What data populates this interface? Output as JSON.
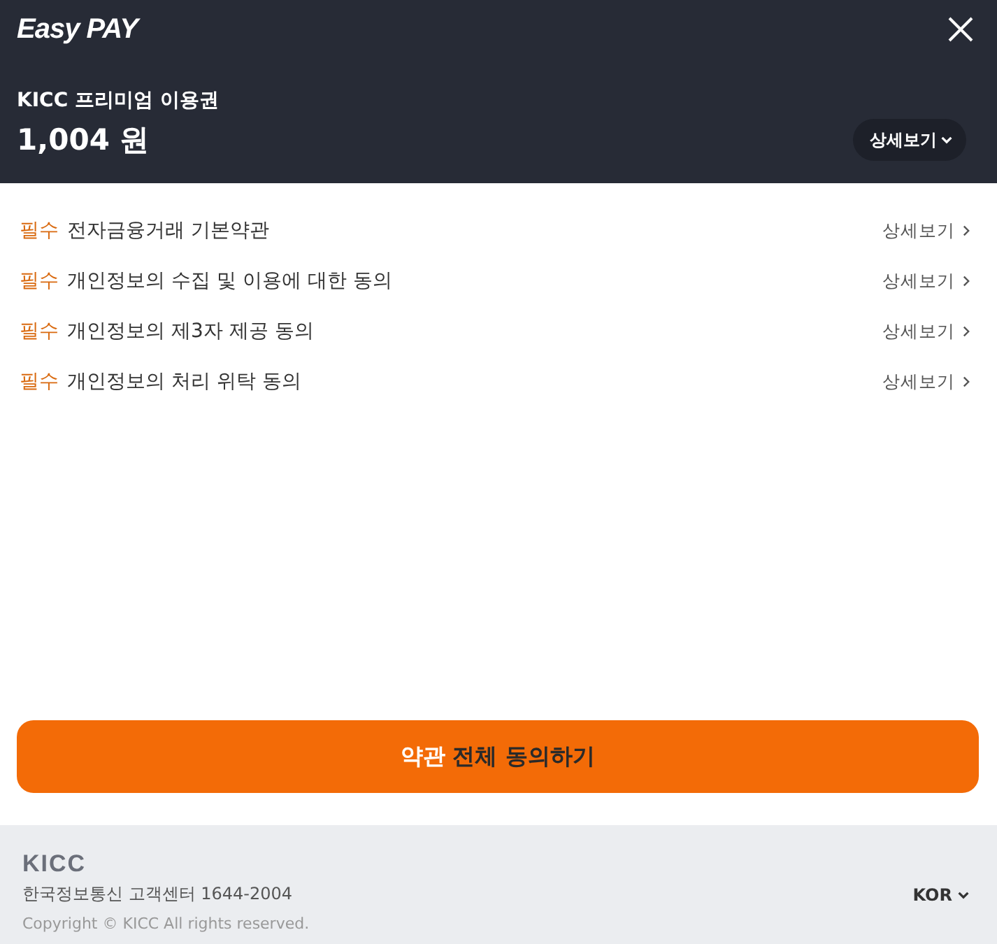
{
  "header": {
    "logo": "Easy PAY",
    "product": "KICC 프리미엄 이용권",
    "price": "1,004 원",
    "details_button": "상세보기"
  },
  "terms": [
    {
      "tag": "필수",
      "title": "전자금융거래 기본약관",
      "link": "상세보기"
    },
    {
      "tag": "필수",
      "title": "개인정보의 수집 및 이용에 대한 동의",
      "link": "상세보기"
    },
    {
      "tag": "필수",
      "title": "개인정보의 제3자 제공 동의",
      "link": "상세보기"
    },
    {
      "tag": "필수",
      "title": "개인정보의 처리 위탁 동의",
      "link": "상세보기"
    }
  ],
  "agree_button": {
    "accent": "약관",
    "label": "전체 동의하기"
  },
  "footer": {
    "logo": "KICC",
    "contact": "한국정보통신 고객센터 1644-2004",
    "copyright": "Copyright © KICC All rights reserved.",
    "language": "KOR"
  }
}
